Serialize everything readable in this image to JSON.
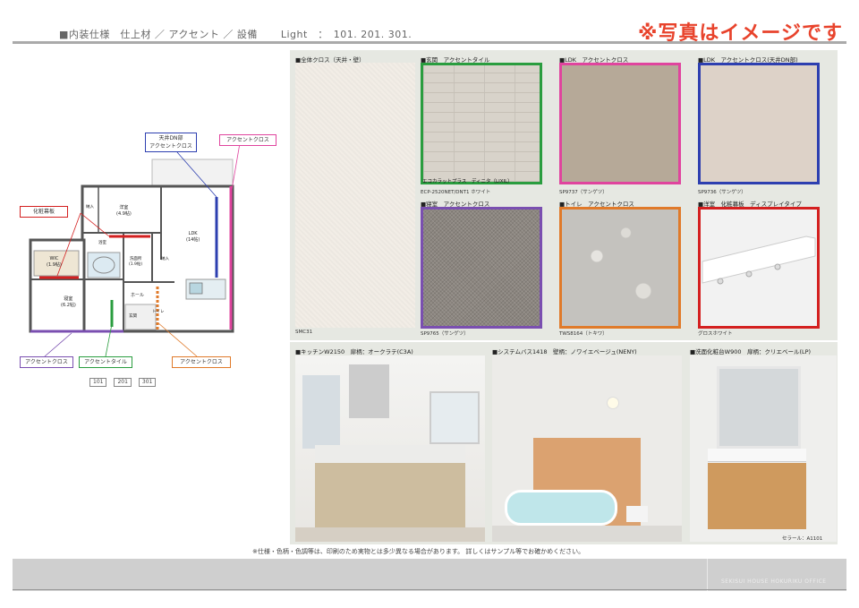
{
  "header": {
    "section": "■内装仕様　仕上材 ／ アクセント ／ 設備",
    "light_label": "Light　：　101. 201. 301.",
    "notice": "※写真はイメージです"
  },
  "floorplan": {
    "callouts": {
      "ceiling_dn": "天井DN部\nアクセントクロス",
      "accent_cloth_top": "アクセントクロス",
      "makeup_board": "化粧幕板",
      "accent_cloth_purple": "アクセントクロス",
      "accent_tile": "アクセントタイル",
      "accent_cloth_orange": "アクセントクロス"
    },
    "rooms": {
      "western1": "洋室\n(4.9帖)",
      "ldk": "LDK\n(14帖)",
      "wic": "WIC\n(1.9帖)",
      "washroom": "洗面所\n(1.9帖)",
      "bedroom": "寝室\n(6.2帖)",
      "hall": "ホール",
      "entrance": "玄関",
      "toilet": "トイレ",
      "storage1": "納入",
      "storage2": "納入",
      "bath": "浴室"
    },
    "units": [
      "101",
      "201",
      "301"
    ],
    "colors": {
      "ceiling": "#2d3fb0",
      "pink": "#e0449e",
      "red": "#d42020",
      "purple": "#7a4fb0",
      "green": "#2a9d3f",
      "orange": "#e07a2a"
    }
  },
  "swatches": [
    {
      "label": "■全体クロス（天井・壁）",
      "code": "SMC31"
    },
    {
      "label": "■玄関　アクセントタイル",
      "caption": "エコカラットプラス　ディニタ（LIXIL）",
      "code": "ECP-2520NET/DNT1 ホワイト",
      "border": "#2a9d3f"
    },
    {
      "label": "■LDK　アクセントクロス",
      "code": "SP9737（サンゲツ）",
      "border": "#e0449e"
    },
    {
      "label": "■LDK　アクセントクロス(天井DN部)",
      "code": "SP9736（サンゲツ）",
      "border": "#2d3fb0"
    },
    {
      "label": "■寝室　アクセントクロス",
      "code": "SP9765（サンゲツ）",
      "border": "#7a4fb0"
    },
    {
      "label": "■トイレ　アクセントクロス",
      "code": "TWS8164（トキワ）",
      "border": "#e07a2a"
    },
    {
      "label": "■洋室　化粧幕板　ディスプレイタイプ",
      "code": "グロスホワイト",
      "border": "#d42020"
    }
  ],
  "equipment": [
    {
      "label": "■キッチンW2150　扉柄：オークラテ(C3A)"
    },
    {
      "label": "■システムバス1418　壁柄：ノワイエベージュ(NENY)"
    },
    {
      "label": "■洗面化粧台W900　扉柄：クリエベール(LP)",
      "code": "セラール：A1101"
    }
  ],
  "footer": {
    "note": "※仕様・色柄・色調等は、印刷のため実物とは多少異なる場合があります。 詳しくはサンプル等でお確かめください。",
    "office": "SEKISUI HOUSE HOKURIKU OFFICE"
  }
}
